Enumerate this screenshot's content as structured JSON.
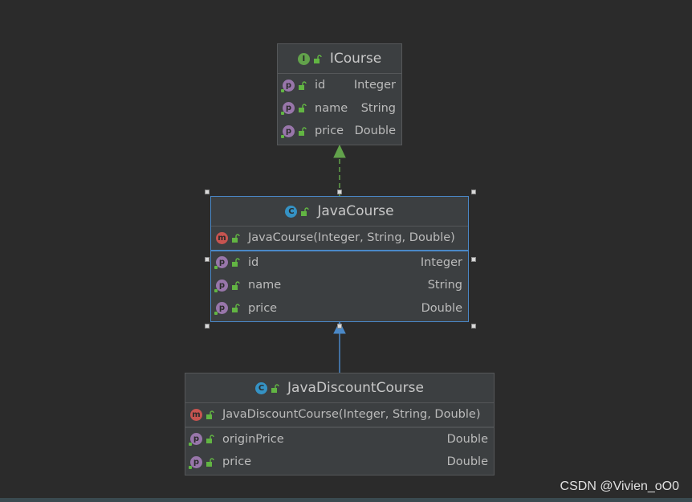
{
  "diagram": {
    "nodes": [
      {
        "id": "icourse",
        "kind": "interface",
        "kind_letter": "I",
        "title": "ICourse",
        "methods": [],
        "fields": [
          {
            "name": "id",
            "type": "Integer"
          },
          {
            "name": "name",
            "type": "String"
          },
          {
            "name": "price",
            "type": "Double"
          }
        ]
      },
      {
        "id": "javacourse",
        "kind": "class",
        "kind_letter": "C",
        "title": "JavaCourse",
        "methods": [
          {
            "name": "JavaCourse(Integer, String, Double)"
          }
        ],
        "fields": [
          {
            "name": "id",
            "type": "Integer"
          },
          {
            "name": "name",
            "type": "String"
          },
          {
            "name": "price",
            "type": "Double"
          }
        ]
      },
      {
        "id": "javadiscountcourse",
        "kind": "class",
        "kind_letter": "C",
        "title": "JavaDiscountCourse",
        "methods": [
          {
            "name": "JavaDiscountCourse(Integer, String, Double)"
          }
        ],
        "fields": [
          {
            "name": "originPrice",
            "type": "Double"
          },
          {
            "name": "price",
            "type": "Double"
          }
        ]
      }
    ],
    "edges": [
      {
        "from": "javacourse",
        "to": "icourse",
        "relation": "implements"
      },
      {
        "from": "javadiscountcourse",
        "to": "javacourse",
        "relation": "extends"
      }
    ],
    "colors": {
      "background": "#2b2b2b",
      "node_fill": "#3c3f41",
      "implements_edge": "#62a24b",
      "extends_edge": "#4a88c7"
    }
  },
  "watermark": "CSDN @Vivien_oO0"
}
